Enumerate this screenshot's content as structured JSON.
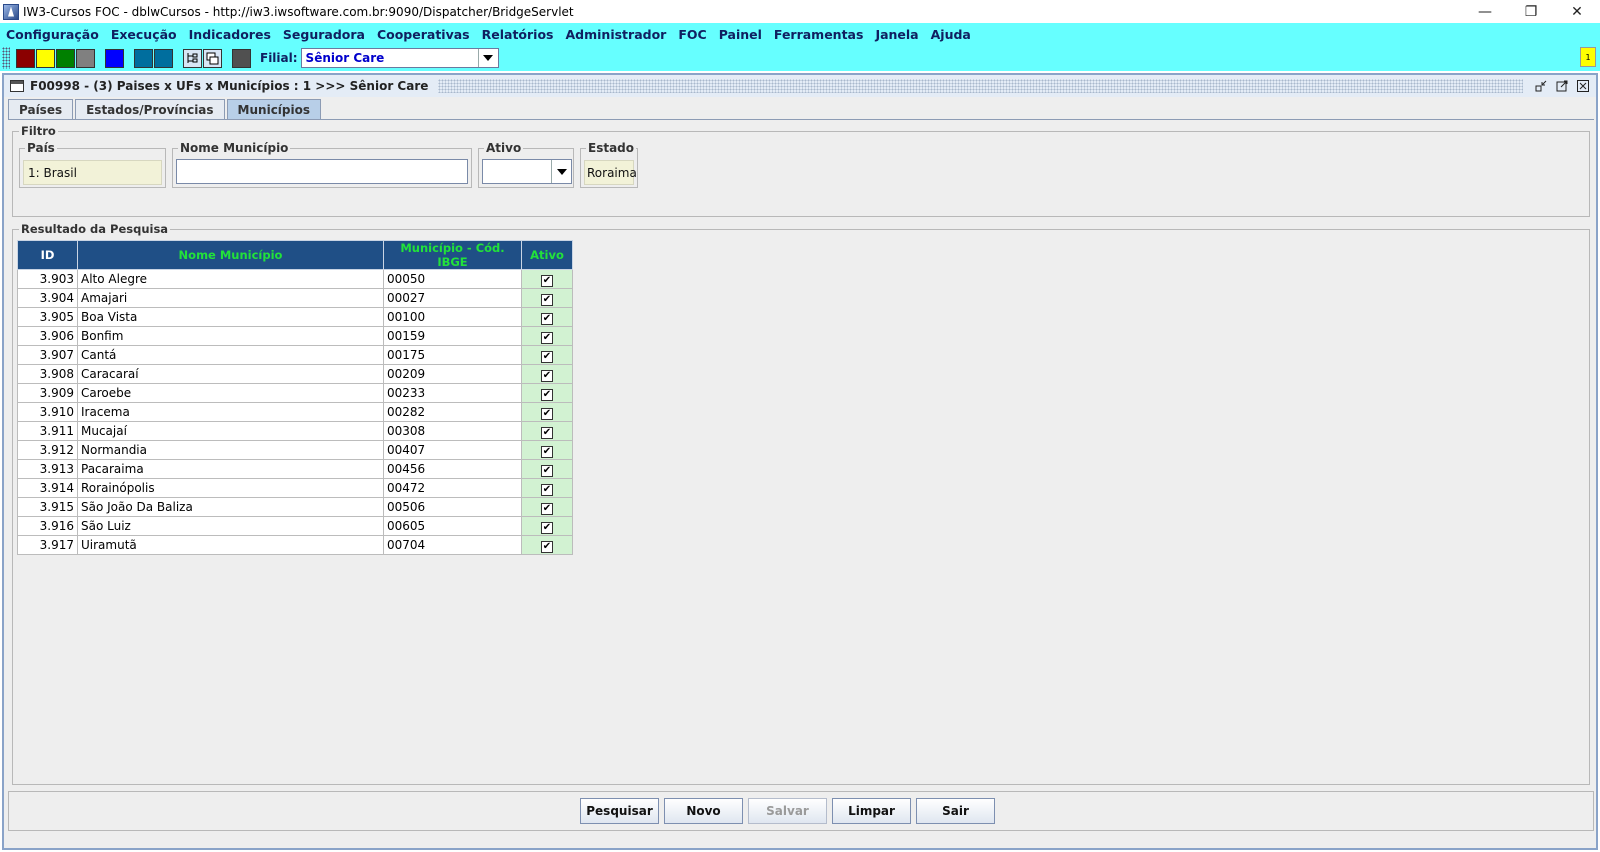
{
  "window": {
    "title": "IW3-Cursos FOC - dblwCursos - http://iw3.iwsoftware.com.br:9090/Dispatcher/BridgeServlet",
    "minimize_glyph": "—",
    "maximize_glyph": "❐",
    "close_glyph": "✕"
  },
  "menu": [
    "Configuração",
    "Execução",
    "Indicadores",
    "Seguradora",
    "Cooperativas",
    "Relatórios",
    "Administrador",
    "FOC",
    "Painel",
    "Ferramentas",
    "Janela",
    "Ajuda"
  ],
  "toolbar": {
    "swatches": [
      "#8b0000",
      "#ffff00",
      "#008000",
      "#808080"
    ],
    "swatch_blue": "#0000ff",
    "swatches_teal": [
      "#006e9e",
      "#006e9e"
    ],
    "swatch_dark": "#505050",
    "filial_label": "Filial:",
    "filial_value": "Sênior Care",
    "notify_count": "1"
  },
  "frame": {
    "title": "F00998 - (3) Paises x UFs x Municípios : 1 >>> Sênior Care"
  },
  "tabs": [
    "Países",
    "Estados/Províncias",
    "Municípios"
  ],
  "active_tab": "Municípios",
  "filter": {
    "legend": "Filtro",
    "pais_label": "País",
    "pais_value": "1: Brasil",
    "nome_label": "Nome Município",
    "nome_value": "",
    "ativo_label": "Ativo",
    "ativo_value": "",
    "estado_label": "Estado",
    "estado_value": "Roraima"
  },
  "result": {
    "legend": "Resultado da Pesquisa",
    "columns": [
      "ID",
      "Nome Município",
      "Município - Cód. IBGE",
      "Ativo"
    ],
    "rows": [
      {
        "id": "3.903",
        "nome": "Alto Alegre",
        "ibge": "00050",
        "ativo": true
      },
      {
        "id": "3.904",
        "nome": "Amajari",
        "ibge": "00027",
        "ativo": true
      },
      {
        "id": "3.905",
        "nome": "Boa Vista",
        "ibge": "00100",
        "ativo": true
      },
      {
        "id": "3.906",
        "nome": "Bonfim",
        "ibge": "00159",
        "ativo": true
      },
      {
        "id": "3.907",
        "nome": "Cantá",
        "ibge": "00175",
        "ativo": true
      },
      {
        "id": "3.908",
        "nome": "Caracaraí",
        "ibge": "00209",
        "ativo": true
      },
      {
        "id": "3.909",
        "nome": "Caroebe",
        "ibge": "00233",
        "ativo": true
      },
      {
        "id": "3.910",
        "nome": "Iracema",
        "ibge": "00282",
        "ativo": true
      },
      {
        "id": "3.911",
        "nome": "Mucajaí",
        "ibge": "00308",
        "ativo": true
      },
      {
        "id": "3.912",
        "nome": "Normandia",
        "ibge": "00407",
        "ativo": true
      },
      {
        "id": "3.913",
        "nome": "Pacaraima",
        "ibge": "00456",
        "ativo": true
      },
      {
        "id": "3.914",
        "nome": "Rorainópolis",
        "ibge": "00472",
        "ativo": true
      },
      {
        "id": "3.915",
        "nome": "São João Da Baliza",
        "ibge": "00506",
        "ativo": true
      },
      {
        "id": "3.916",
        "nome": "São Luiz",
        "ibge": "00605",
        "ativo": true
      },
      {
        "id": "3.917",
        "nome": "Uiramutã",
        "ibge": "00704",
        "ativo": true
      }
    ]
  },
  "buttons": {
    "pesquisar": "Pesquisar",
    "novo": "Novo",
    "salvar": "Salvar",
    "limpar": "Limpar",
    "sair": "Sair"
  }
}
